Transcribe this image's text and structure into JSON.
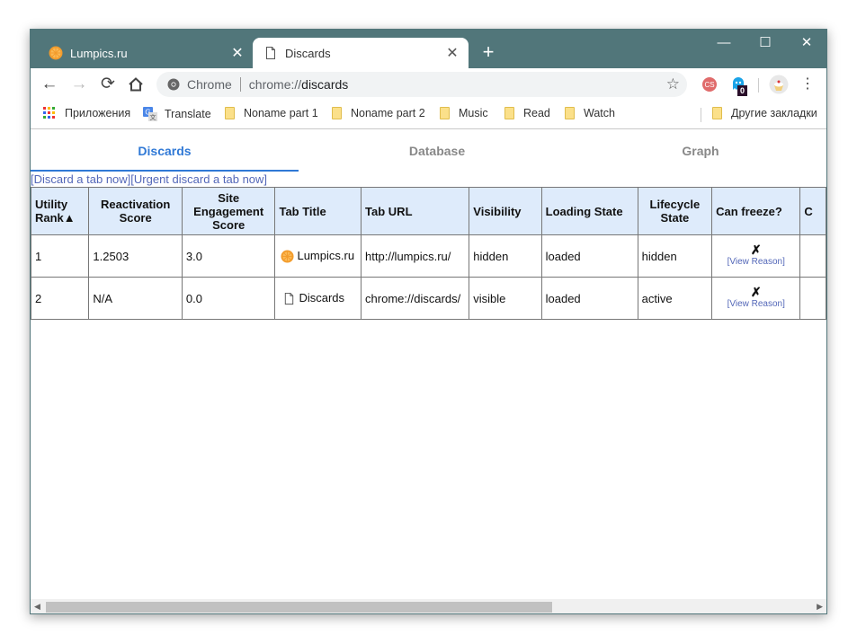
{
  "browser": {
    "tabs": [
      {
        "title": "Lumpics.ru",
        "favicon": "orange-slice-icon",
        "active": false
      },
      {
        "title": "Discards",
        "favicon": "page-icon",
        "active": true
      }
    ],
    "new_tab_label": "+",
    "window_controls": {
      "minimize": "—",
      "maximize": "☐",
      "close": "✕"
    },
    "omnibox": {
      "scheme_label": "Chrome",
      "url_prefix": "chrome://",
      "url_host": "discards"
    },
    "extensions": [
      {
        "name": "cs-extension-icon"
      },
      {
        "name": "ghostery-icon",
        "badge": "0"
      },
      {
        "name": "profile-avatar"
      }
    ]
  },
  "bookmarks": {
    "apps_label": "Приложения",
    "items": [
      "Translate",
      "Noname part 1",
      "Noname part 2",
      "Music",
      "Read",
      "Watch"
    ],
    "other_label": "Другие закладки"
  },
  "page": {
    "nav_tabs": [
      {
        "label": "Discards",
        "selected": true
      },
      {
        "label": "Database",
        "selected": false
      },
      {
        "label": "Graph",
        "selected": false
      }
    ],
    "actions": {
      "discard": "[Discard a tab now]",
      "urgent_discard": "[Urgent discard a tab now]"
    },
    "table": {
      "headers": {
        "utility_rank": "Utility Rank",
        "sort_arrow": "▲",
        "reactivation": "Reactivation Score",
        "site_engagement": "Site Engagement Score",
        "tab_title": "Tab Title",
        "tab_url": "Tab URL",
        "visibility": "Visibility",
        "loading_state": "Loading State",
        "lifecycle_state": "Lifecycle State",
        "can_freeze": "Can freeze?",
        "next_truncated": "C"
      },
      "rows": [
        {
          "rank": "1",
          "reactivation": "1.2503",
          "engagement": "3.0",
          "title": "Lumpics.ru",
          "url": "http://lumpics.ru/",
          "visibility": "hidden",
          "loading": "loaded",
          "lifecycle": "hidden",
          "freeze": "✗",
          "reason": "[View Reason]"
        },
        {
          "rank": "2",
          "reactivation": "N/A",
          "engagement": "0.0",
          "title": "Discards",
          "url": "chrome://discards/",
          "visibility": "visible",
          "loading": "loaded",
          "lifecycle": "active",
          "freeze": "✗",
          "reason": "[View Reason]"
        }
      ]
    }
  },
  "colors": {
    "titlebar": "#51767a",
    "accent": "#3079d6",
    "link": "#5367b8",
    "table_header": "#deebfb"
  }
}
